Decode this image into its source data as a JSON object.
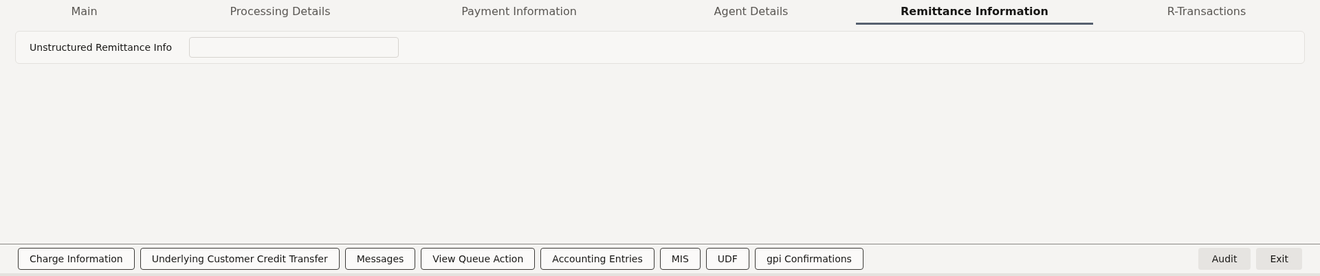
{
  "tabs": [
    {
      "label": "Main",
      "selected": false
    },
    {
      "label": "Processing Details",
      "selected": false
    },
    {
      "label": "Payment Information",
      "selected": false
    },
    {
      "label": "Agent Details",
      "selected": false
    },
    {
      "label": "Remittance Information",
      "selected": true
    },
    {
      "label": "R-Transactions",
      "selected": false
    }
  ],
  "form": {
    "fields": [
      {
        "label": "Unstructured Remittance Info"
      }
    ]
  },
  "footer": {
    "buttons": [
      {
        "label": "Charge Information",
        "kind": "outline"
      },
      {
        "label": "Underlying Customer Credit Transfer",
        "kind": "outline"
      },
      {
        "label": "Messages",
        "kind": "outline"
      },
      {
        "label": "View Queue Action",
        "kind": "outline"
      },
      {
        "label": "Accounting Entries",
        "kind": "outline"
      },
      {
        "label": "MIS",
        "kind": "outline"
      },
      {
        "label": "UDF",
        "kind": "outline"
      },
      {
        "label": "gpi Confirmations",
        "kind": "outline"
      },
      {
        "label": "Audit",
        "kind": "flat"
      },
      {
        "label": "Exit",
        "kind": "flat"
      }
    ]
  }
}
